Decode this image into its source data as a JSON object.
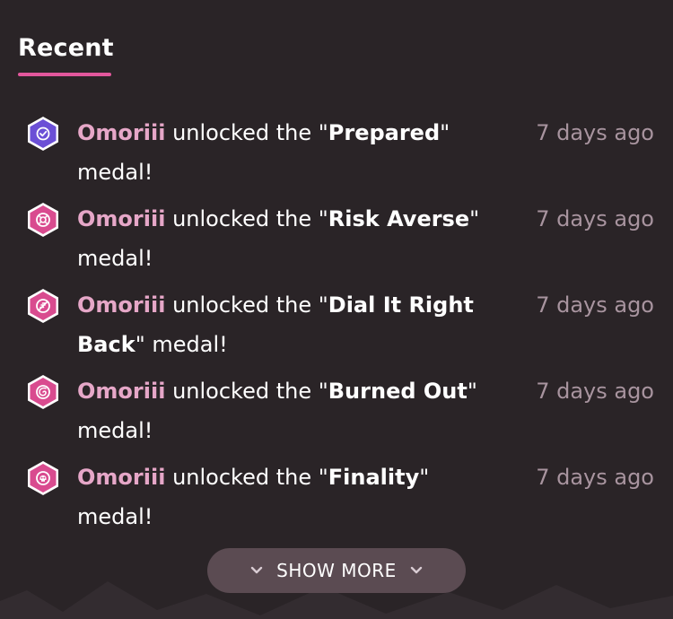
{
  "section_title": "Recent",
  "items": [
    {
      "user": "Omoriii",
      "pre": "unlocked the \"",
      "medal": "Prepared",
      "post": "\" medal!",
      "time": "7 days ago",
      "badge_color": "#6b4fd6",
      "badge_icon": "check-circle-icon"
    },
    {
      "user": "Omoriii",
      "pre": "unlocked the \"",
      "medal": "Risk Averse",
      "post": "\" medal!",
      "time": "7 days ago",
      "badge_color": "#d94b8f",
      "badge_icon": "lifebuoy-icon"
    },
    {
      "user": "Omoriii",
      "pre": "unlocked the \"",
      "medal": "Dial It Right Back",
      "post": "\" medal!",
      "time": "7 days ago",
      "badge_color": "#d94b8f",
      "badge_icon": "feather-icon"
    },
    {
      "user": "Omoriii",
      "pre": "unlocked the \"",
      "medal": "Burned Out",
      "post": "\" medal!",
      "time": "7 days ago",
      "badge_color": "#d94b8f",
      "badge_icon": "swirl-icon"
    },
    {
      "user": "Omoriii",
      "pre": "unlocked the \"",
      "medal": "Finality",
      "post": "\" medal!",
      "time": "7 days ago",
      "badge_color": "#d94b8f",
      "badge_icon": "skull-icon"
    }
  ],
  "show_more_label": "SHOW MORE",
  "colors": {
    "background": "#2a2427",
    "accent": "#e2579c",
    "username": "#e6a7c8",
    "timestamp": "#a8949f",
    "button_bg": "#5b4b52"
  }
}
